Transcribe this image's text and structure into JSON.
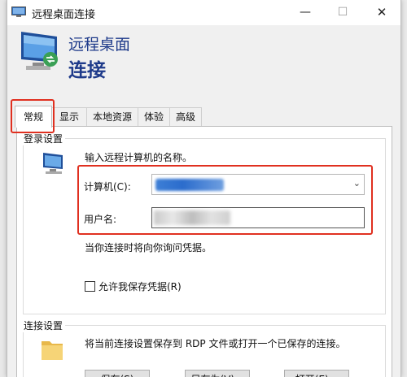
{
  "window": {
    "title": "远程桌面连接",
    "controls": {
      "minimize": "—",
      "maximize": "☐",
      "close": "✕"
    }
  },
  "banner": {
    "line1": "远程桌面",
    "line2": "连接"
  },
  "tabs": [
    {
      "label": "常规",
      "active": true
    },
    {
      "label": "显示"
    },
    {
      "label": "本地资源"
    },
    {
      "label": "体验"
    },
    {
      "label": "高级"
    }
  ],
  "login_settings": {
    "group_label": "登录设置",
    "prompt": "输入远程计算机的名称。",
    "computer_label": "计算机(C):",
    "user_label": "用户名:",
    "hint": "当你连接时将向你询问凭据。",
    "save_credentials_label": "允许我保存凭据(R)",
    "save_credentials_checked": false
  },
  "connection_settings": {
    "group_label": "连接设置",
    "description": "将当前连接设置保存到 RDP 文件或打开一个已保存的连接。",
    "buttons": [
      "保存(S)",
      "另存为(V)...",
      "打开(E)..."
    ]
  },
  "colors": {
    "highlight": "#e03020",
    "banner_text": "#1e3a8a"
  },
  "icons": [
    "remote-desktop-icon",
    "computer-icon",
    "folder-icon",
    "chevron-down-icon"
  ]
}
